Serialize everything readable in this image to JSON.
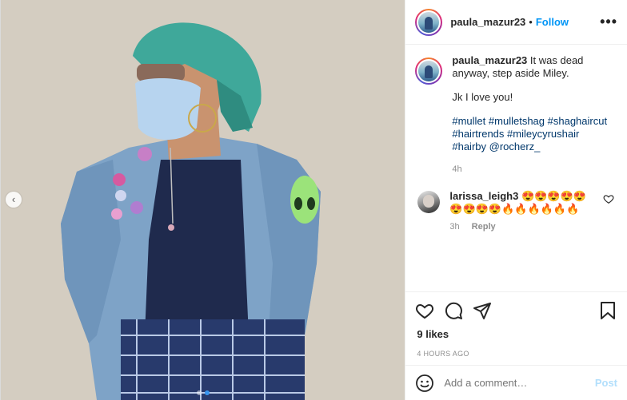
{
  "post": {
    "author": "paula_mazur23",
    "follow_label": "Follow",
    "separator": "•",
    "more_label": "•••",
    "caption": {
      "username": "paula_mazur23",
      "line1": "It was dead anyway, step aside Miley.",
      "line2": "Jk I love you!",
      "hashtags": [
        "#mullet",
        "#mulletshag",
        "#shaghaircut",
        "#hairtrends",
        "#mileycyrushair",
        "#hairby"
      ],
      "mention": "@rocherz_",
      "time": "4h"
    },
    "comment": {
      "username": "larissa_leigh3",
      "text": "😍😍😍😍😍😍😍😍😍🔥🔥🔥🔥🔥🔥",
      "time": "3h",
      "reply_label": "Reply"
    },
    "likes": "9 likes",
    "timestamp": "4 HOURS AGO",
    "add_comment_placeholder": "Add a comment…",
    "post_button": "Post"
  },
  "carousel": {
    "prev_icon": "‹"
  },
  "icons": {
    "more": "more-options-icon",
    "like": "heart-icon",
    "comment": "comment-bubble-icon",
    "share": "paper-plane-icon",
    "save": "bookmark-icon",
    "emoji": "emoji-icon",
    "comment_like": "heart-icon",
    "prev": "chevron-left-icon"
  },
  "colors": {
    "link": "#0095f6",
    "hashtag": "#00376b",
    "muted": "#8e8e8e"
  }
}
